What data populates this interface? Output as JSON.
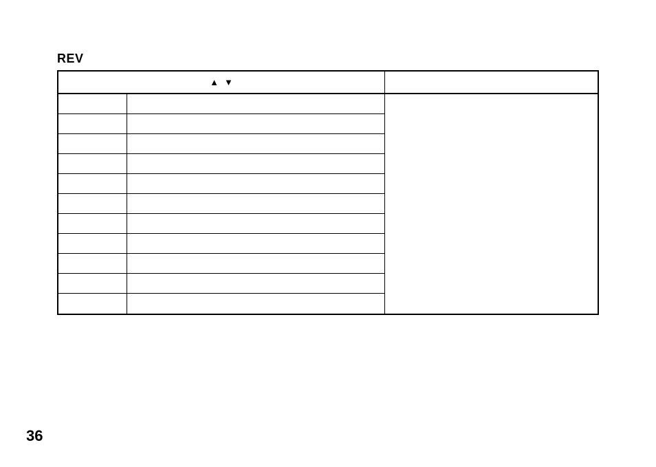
{
  "title": "REV",
  "header": {
    "arrow_up": "▲",
    "arrow_down": "▼"
  },
  "rows": [
    {
      "col1": "",
      "col2": ""
    },
    {
      "col1": "",
      "col2": ""
    },
    {
      "col1": "",
      "col2": ""
    },
    {
      "col1": "",
      "col2": ""
    },
    {
      "col1": "",
      "col2": ""
    },
    {
      "col1": "",
      "col2": ""
    },
    {
      "col1": "",
      "col2": ""
    },
    {
      "col1": "",
      "col2": ""
    },
    {
      "col1": "",
      "col2": ""
    },
    {
      "col1": "",
      "col2": ""
    },
    {
      "col1": "",
      "col2": ""
    }
  ],
  "right_content": "",
  "page_number": "36"
}
